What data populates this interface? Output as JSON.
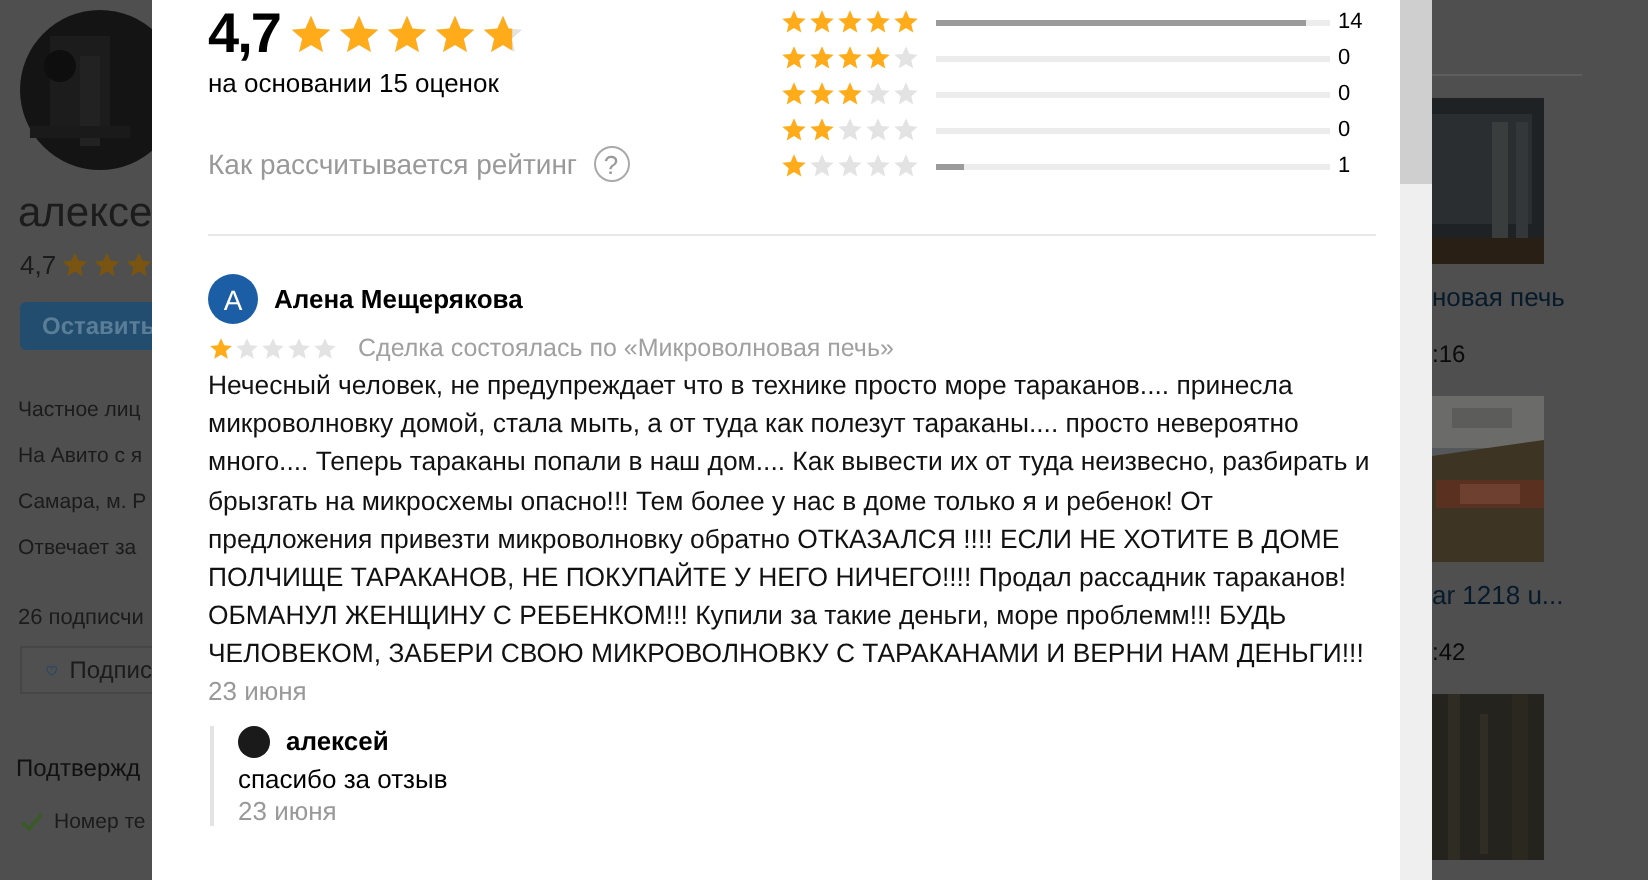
{
  "background": {
    "profile": {
      "name": "алексе",
      "rating": "4,7",
      "stars": 3,
      "button": "Оставить",
      "info": [
        "Частное лиц",
        "На Авито с я",
        "Самара, м. Р",
        "Отвечает за"
      ],
      "subscribers": "26 подписчи",
      "subscribe_button": "Подпис",
      "section_title": "Подтвержд",
      "verified": [
        {
          "label": "Номер те",
          "checked": true
        }
      ]
    },
    "listings": [
      {
        "kind": "picture",
        "title": "новая печь",
        "time": ":16"
      },
      {
        "kind": "picture",
        "title": "ar 1218 u...",
        "time": ":42"
      },
      {
        "kind": "picture"
      }
    ]
  },
  "rating_summary": {
    "score": "4,7",
    "stars": 4.7,
    "caption": "на основании 15 оценок",
    "help_link": "Как рассчитывается рейтинг",
    "help_icon": "?"
  },
  "distribution": [
    {
      "stars": 5,
      "level": 0.94,
      "count": "14"
    },
    {
      "stars": 4,
      "level": 0,
      "count": "0"
    },
    {
      "stars": 3,
      "level": 0,
      "count": "0"
    },
    {
      "stars": 2,
      "level": 0,
      "count": "0"
    },
    {
      "stars": 1,
      "level": 0.07,
      "count": "1"
    }
  ],
  "review": {
    "author": "Алена Мещерякова",
    "avatar_letter": "А",
    "stars": 1,
    "deal": "Сделка состоялась по «Микроволновая печь»",
    "text": "Нечесный человек, не предупреждает что в технике просто море тараканов.... принесла микроволновку домой, стала мыть, а от туда как полезут тараканы.... просто невероятно много.... Теперь тараканы попали в наш дом.... Как вывести их от туда неизвесно, разбирать и брызгать на микросхемы опасно!!! Тем более у нас в доме только я и ребенок! От предложения привезти микроволновку обратно ОТКАЗАЛСЯ !!!! ЕСЛИ НЕ ХОТИТЕ В ДОМЕ ПОЛЧИЩЕ ТАРАКАНОВ, НЕ ПОКУПАЙТЕ У НЕГО НИЧЕГО!!!! Продал рассадник тараканов! ОБМАНУЛ ЖЕНЩИНУ С РЕБЕНКОМ!!! Купили за такие деньги, море проблемм!!! БУДЬ ЧЕЛОВЕКОМ, ЗАБЕРИ СВОЮ МИКРОВОЛНОВКУ С ТАРАКАНАМИ И ВЕРНИ НАМ ДЕНЬГИ!!!",
    "date": "23 июня",
    "reply": {
      "author": "алексей",
      "text": "спасибо за отзыв",
      "date": "23 июня"
    }
  }
}
